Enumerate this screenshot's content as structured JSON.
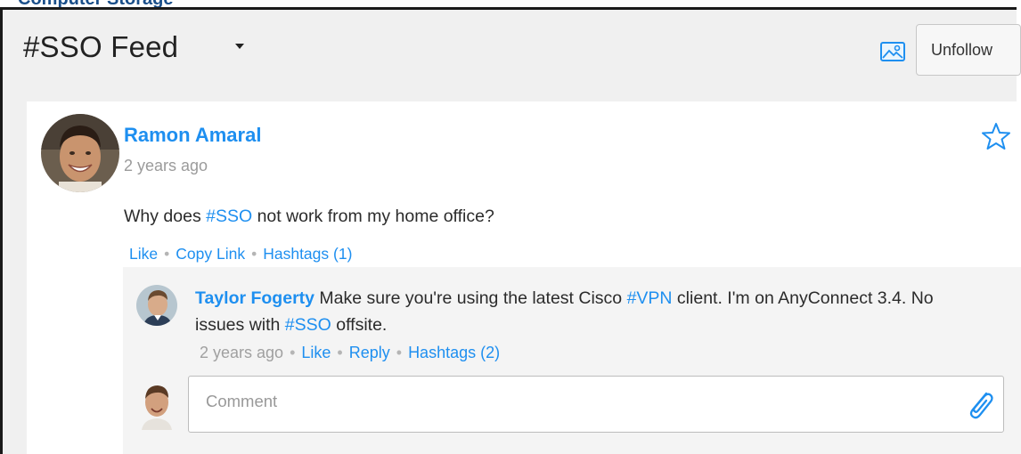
{
  "header": {
    "title": "#SSO Feed",
    "unfollow_label": "Unfollow",
    "image_icon": "image-icon",
    "cropped_top_text": "Computer Storage"
  },
  "post": {
    "author": "Ramon Amaral",
    "time": "2 years ago",
    "body_before": "Why does ",
    "body_hashtag": "#SSO",
    "body_after": " not work from my home office?",
    "star_icon": "star-outline-icon",
    "actions": {
      "like": "Like",
      "copy_link": "Copy Link",
      "hashtags": "Hashtags (1)"
    }
  },
  "reply": {
    "author": "Taylor Fogerty",
    "text_part1": " Make sure you're using the latest Cisco ",
    "hashtag1": "#VPN",
    "text_part2": " client. I'm on AnyConnect 3.4. No issues with ",
    "hashtag2": "#SSO",
    "text_part3": " offsite.",
    "time": "2 years ago",
    "actions": {
      "like": "Like",
      "reply": "Reply",
      "hashtags": "Hashtags (2)"
    }
  },
  "composer": {
    "placeholder": "Comment",
    "attach_icon": "paperclip-icon"
  },
  "colors": {
    "link": "#1e8ff0",
    "muted": "#9b9b9b",
    "panel": "#f0f0f0",
    "comment_bg": "#f4f4f4"
  }
}
